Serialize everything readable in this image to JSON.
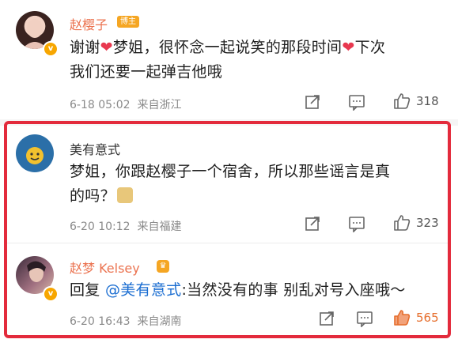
{
  "comments": [
    {
      "author": "赵樱子",
      "badge": "博主",
      "text_parts": [
        "谢谢",
        "梦姐，很怀念一起说笑的那段时间",
        "下次我们还要一起弹吉他哦"
      ],
      "text_line1_a": "谢谢",
      "text_line1_b": "梦姐，很怀念一起说笑的那段时间",
      "text_line2": "我们还要一起弹吉他哦",
      "text_line1_c": "下次",
      "time": "6-18 05:02",
      "location": "来自浙江",
      "likes": "318"
    },
    {
      "author": "美有意式",
      "text_line1": "梦姐，你跟赵樱子一个宿舍，所以那些谣言是真",
      "text_line2": "的吗？",
      "time": "6-20 10:12",
      "location": "来自福建",
      "likes": "323"
    },
    {
      "author": "赵梦 Kelsey",
      "reply_prefix": "回复",
      "mention": "@美有意式",
      "reply_text": ":当然没有的事 别乱对号入座哦～",
      "time": "6-20 16:43",
      "location": "来自湖南",
      "likes": "565"
    }
  ],
  "colors": {
    "accent": "#eb7350",
    "highlight": "#e32b3c",
    "mention": "#1a6dd1",
    "liked": "#e66e2d"
  },
  "icons": [
    "share-icon",
    "comment-icon",
    "like-icon",
    "verified-icon",
    "crown-icon",
    "heart-emoji",
    "doge-emoji"
  ]
}
